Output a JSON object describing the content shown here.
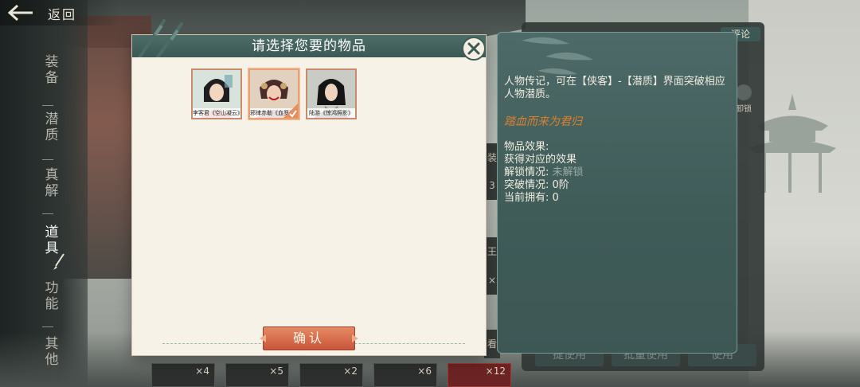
{
  "header": {
    "back_label": "返回"
  },
  "nav": {
    "items": [
      {
        "chars": [
          "装",
          "备"
        ]
      },
      {
        "chars": [
          "潜",
          "质"
        ]
      },
      {
        "chars": [
          "真",
          "解"
        ]
      },
      {
        "chars": [
          "道",
          "具"
        ]
      },
      {
        "chars": [
          "功",
          "能"
        ]
      },
      {
        "chars": [
          "其",
          "他"
        ]
      }
    ],
    "active": "道具"
  },
  "background": {
    "review_label": "评论",
    "lock_label": "卸锁",
    "buttons": [
      "提使用",
      "批量使用",
      "使用"
    ],
    "slots": [
      "×4",
      "×5",
      "×2",
      "×6",
      "×12"
    ],
    "side_tabs": [
      "装",
      "3",
      "王",
      "×",
      "看"
    ]
  },
  "modal": {
    "title": "请选择您要的物品",
    "confirm_label": "确认",
    "items": [
      {
        "caption": "李客君《空山凝云》",
        "selected": false
      },
      {
        "caption": "邪律赤勒《血罗刹》",
        "selected": true
      },
      {
        "caption": "陆游《惊鸿照影》",
        "selected": false
      }
    ]
  },
  "info": {
    "description": "人物传记，可在【侠客】-【潜质】界面突破相应人物潜质。",
    "source": "踏血而来为君归",
    "effect_label": "物品效果:",
    "effect_value": "获得对应的效果",
    "unlock_label": "解锁情况:",
    "unlock_value": "未解锁",
    "breakthrough_label": "突破情况:",
    "breakthrough_value": "0阶",
    "owned_label": "当前拥有:",
    "owned_value": "0"
  },
  "colors": {
    "accent_teal": "#3b5955",
    "confirm_red": "#c9553a",
    "source_orange": "#d9812f",
    "parchment": "#f6f2e7"
  }
}
